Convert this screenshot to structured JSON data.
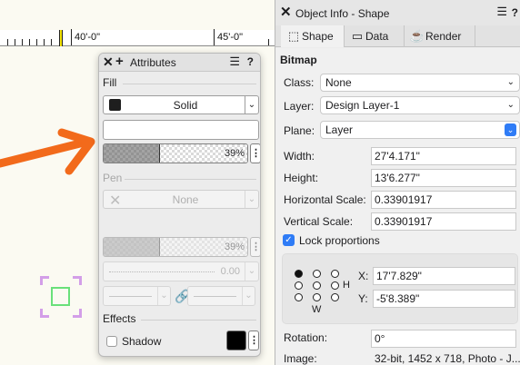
{
  "ruler": {
    "label_1": "40'-0\"",
    "label_2": "45'-0\""
  },
  "attributes": {
    "title": "Attributes",
    "fill": {
      "label": "Fill",
      "style": "Solid",
      "name": "",
      "opacity": 0.39,
      "opacity_label": "39%"
    },
    "pen": {
      "label": "Pen",
      "style": "None",
      "opacity": 0.39,
      "opacity_label": "39%",
      "thickness": "0.00"
    },
    "effects": {
      "label": "Effects",
      "shadow_label": "Shadow",
      "shadow_checked": false,
      "shadow_color": "#000000"
    }
  },
  "object_info": {
    "title": "Object Info - Shape",
    "tabs": [
      {
        "label": "Shape",
        "icon": "shape-icon",
        "active": true
      },
      {
        "label": "Data",
        "icon": "data-icon",
        "active": false
      },
      {
        "label": "Render",
        "icon": "teapot-icon",
        "active": false
      }
    ],
    "heading": "Bitmap",
    "class": {
      "label": "Class:",
      "value": "None"
    },
    "layer": {
      "label": "Layer:",
      "value": "Design Layer-1"
    },
    "plane": {
      "label": "Plane:",
      "value": "Layer"
    },
    "width": {
      "label": "Width:",
      "value": "27'4.171\""
    },
    "height": {
      "label": "Height:",
      "value": "13'6.277\""
    },
    "h_scale": {
      "label": "Horizontal Scale:",
      "value": "0.33901917"
    },
    "v_scale": {
      "label": "Vertical Scale:",
      "value": "0.33901917"
    },
    "lock": {
      "label": "Lock proportions",
      "checked": true
    },
    "origin": {
      "letters": [
        "H",
        "W"
      ],
      "x_label": "X:",
      "x_value": "17'7.829\"",
      "y_label": "Y:",
      "y_value": "-5'8.389\""
    },
    "rotation": {
      "label": "Rotation:",
      "value": "0°"
    },
    "image": {
      "label": "Image:",
      "value": "32-bit, 1452 x 718, Photo - J..."
    }
  },
  "colors": {
    "accent": "#2f7cf6",
    "arrow": "#f26a1b",
    "selection_handles": "#d39ee8",
    "shape_outline": "#69e07a"
  }
}
